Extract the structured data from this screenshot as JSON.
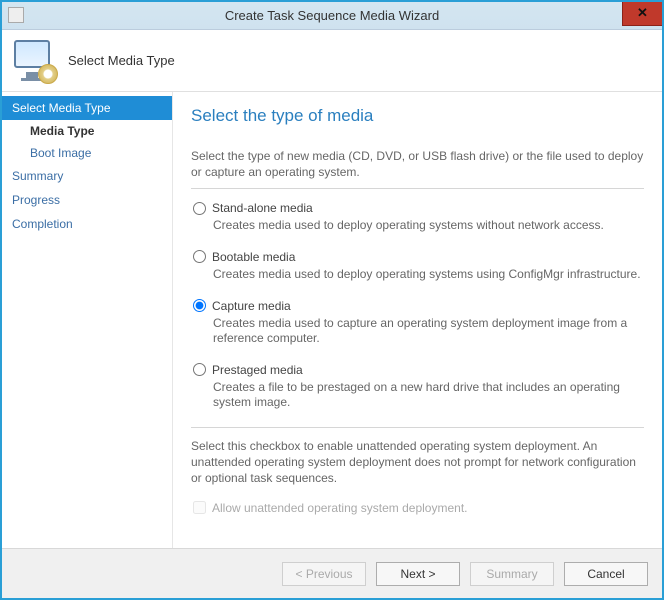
{
  "window": {
    "title": "Create Task Sequence Media Wizard",
    "close_glyph": "✕"
  },
  "header": {
    "title": "Select Media Type"
  },
  "sidebar": {
    "steps": [
      {
        "label": "Select Media Type",
        "selected": true
      },
      {
        "label": "Media Type",
        "sub": true,
        "current": true
      },
      {
        "label": "Boot Image",
        "sub": true,
        "current": false
      },
      {
        "label": "Summary",
        "selected": false
      },
      {
        "label": "Progress",
        "selected": false
      },
      {
        "label": "Completion",
        "selected": false
      }
    ]
  },
  "content": {
    "title": "Select the type of media",
    "intro": "Select the type of new media (CD, DVD, or USB flash drive) or the file used to deploy or capture an operating system.",
    "options": [
      {
        "id": "standalone",
        "label": "Stand-alone media",
        "desc": "Creates media used to deploy operating systems without network access.",
        "checked": false
      },
      {
        "id": "bootable",
        "label": "Bootable media",
        "desc": "Creates media used to deploy operating systems using ConfigMgr infrastructure.",
        "checked": false
      },
      {
        "id": "capture",
        "label": "Capture media",
        "desc": "Creates media used to capture an operating system deployment image from a reference computer.",
        "checked": true
      },
      {
        "id": "prestaged",
        "label": "Prestaged media",
        "desc": "Creates a file to be prestaged on a new hard drive that includes an operating system image.",
        "checked": false
      }
    ],
    "unattended_note": "Select this checkbox to enable unattended operating system deployment. An unattended operating system deployment does not prompt for network configuration or optional task sequences.",
    "unattended_label": "Allow unattended operating system deployment.",
    "unattended_enabled": false
  },
  "footer": {
    "previous": "< Previous",
    "next": "Next >",
    "summary": "Summary",
    "cancel": "Cancel"
  }
}
